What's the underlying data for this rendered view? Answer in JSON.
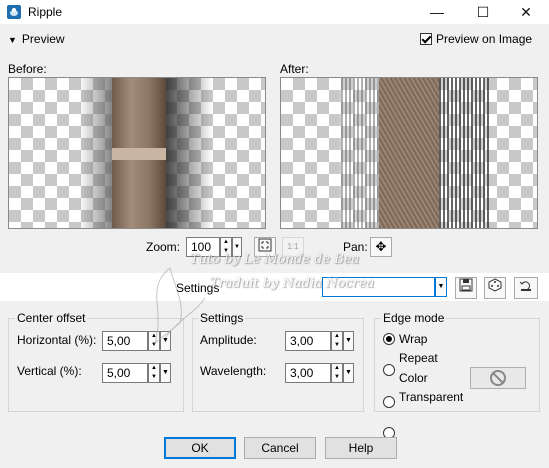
{
  "window": {
    "title": "Ripple",
    "minimize": "—",
    "maximize": "☐",
    "close": "✕"
  },
  "preview": {
    "toggle_label": "Preview",
    "preview_on_image_label": "Preview on Image",
    "preview_on_image_checked": true
  },
  "before_label": "Before:",
  "after_label": "After:",
  "zoom": {
    "label": "Zoom:",
    "value": "100"
  },
  "pan_label": "Pan:",
  "presets": {
    "label": "Settings",
    "value": ""
  },
  "center_offset": {
    "title": "Center offset",
    "horizontal_label": "Horizontal (%):",
    "horizontal_value": "5,00",
    "vertical_label": "Vertical (%):",
    "vertical_value": "5,00"
  },
  "settings": {
    "title": "Settings",
    "amplitude_label": "Amplitude:",
    "amplitude_value": "3,00",
    "wavelength_label": "Wavelength:",
    "wavelength_value": "3,00"
  },
  "edge_mode": {
    "title": "Edge mode",
    "options": [
      "Wrap",
      "Repeat",
      "Color",
      "Transparent"
    ],
    "selected": "Wrap"
  },
  "buttons": {
    "ok": "OK",
    "cancel": "Cancel",
    "help": "Help"
  },
  "watermark": {
    "line1": "Tuto by Le Monde de Bea",
    "line2": "Traduit by Nadia Nocrea"
  },
  "colors": {
    "accent": "#0078d7",
    "window_bg": "#f0f0f0",
    "title_bg": "#ffffff",
    "image_brown": "#8b7563"
  },
  "icons": [
    "ripple-app-icon",
    "chevron-down-icon",
    "checkmark-icon",
    "fit-zoom-icon",
    "actual-size-icon",
    "pan-move-icon",
    "save-preset-icon",
    "randomize-dice-icon",
    "reset-default-icon",
    "no-color-icon"
  ]
}
